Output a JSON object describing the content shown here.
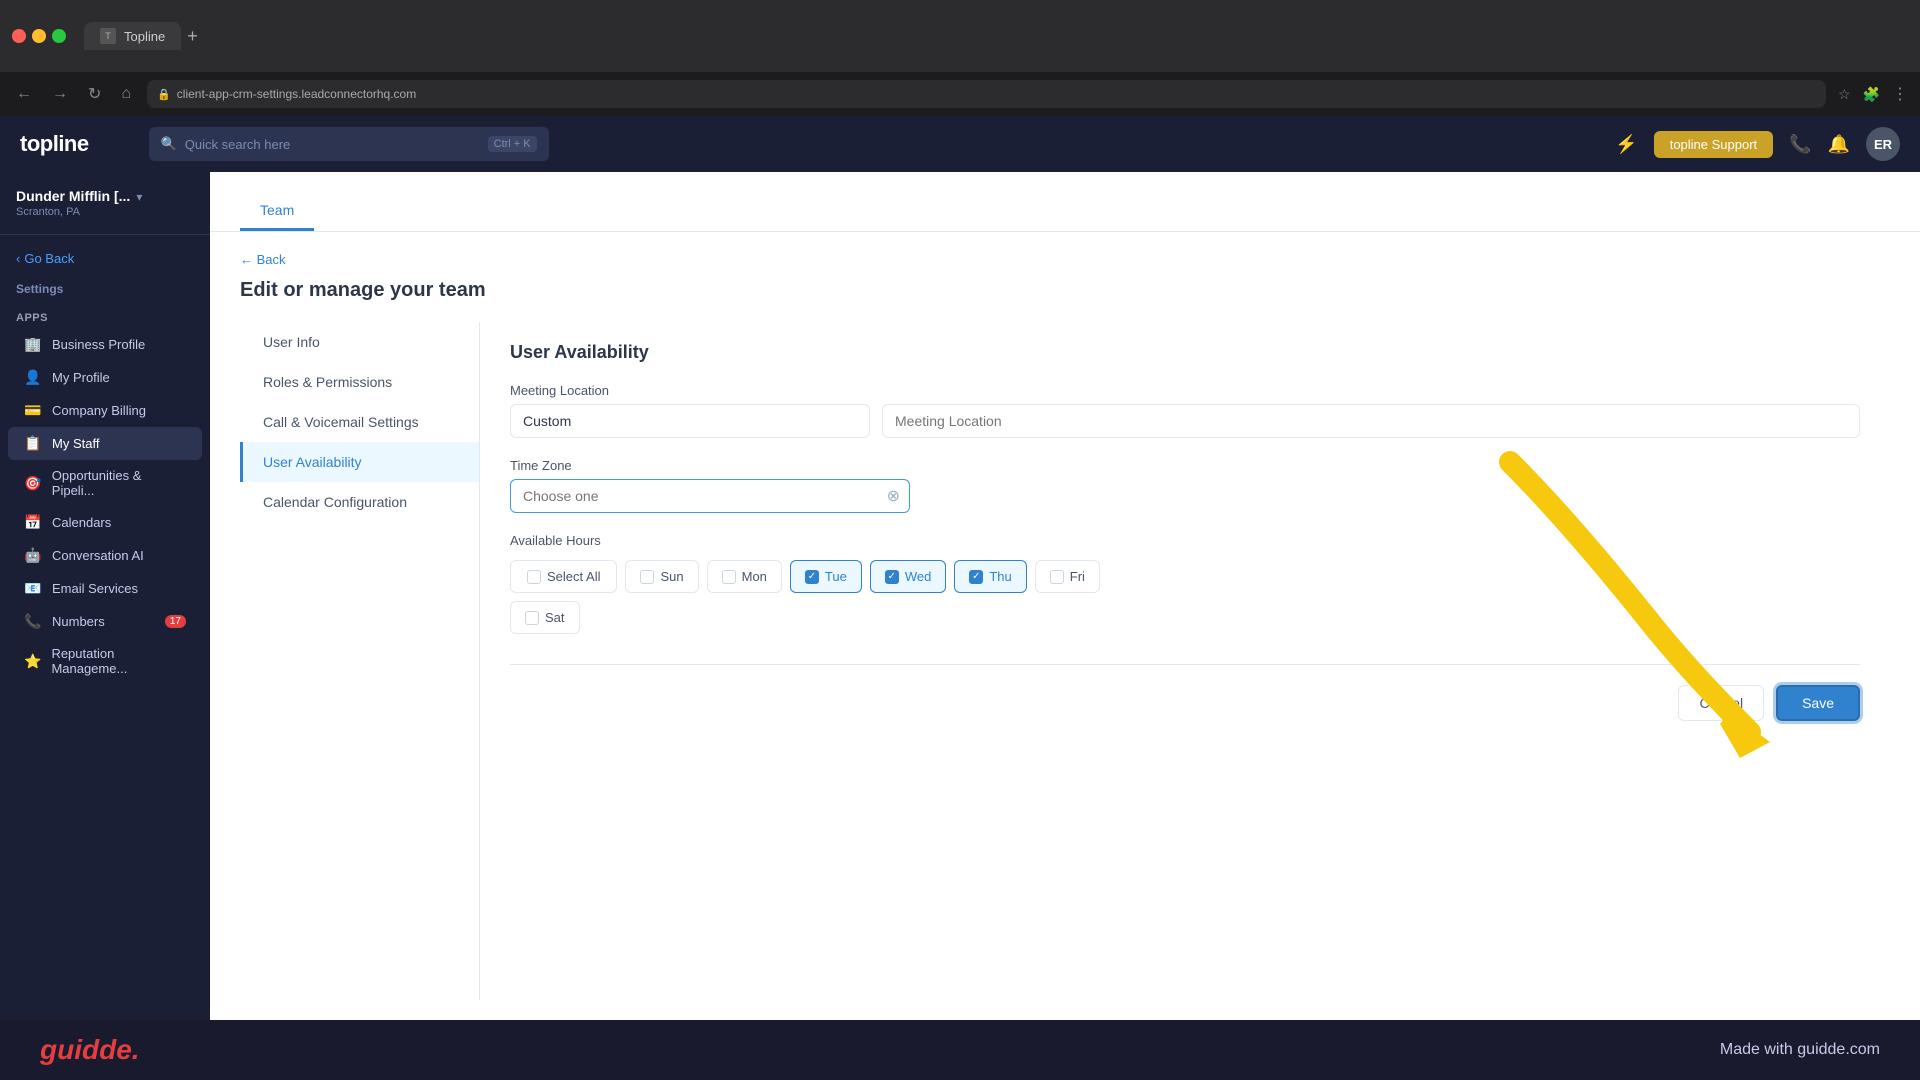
{
  "browser": {
    "tab_title": "Topline",
    "address": "client-app-crm-settings.leadconnectorhq.com",
    "add_tab_label": "+"
  },
  "topnav": {
    "logo": "topline",
    "search_placeholder": "Quick search here",
    "search_shortcut": "Ctrl + K",
    "support_btn": "topline Support",
    "avatar_initials": "ER"
  },
  "sidebar": {
    "org_name": "Dunder Mifflin [...",
    "org_location": "Scranton, PA",
    "go_back": "Go Back",
    "settings_label": "Settings",
    "apps_label": "Apps",
    "items": [
      {
        "id": "business-profile",
        "label": "Business Profile",
        "icon": "🏢",
        "badge": null
      },
      {
        "id": "my-profile",
        "label": "My Profile",
        "icon": "👤",
        "badge": null
      },
      {
        "id": "company-billing",
        "label": "Company Billing",
        "icon": "💳",
        "badge": null
      },
      {
        "id": "my-staff",
        "label": "My Staff",
        "icon": "📋",
        "badge": null,
        "active": true
      },
      {
        "id": "opportunities",
        "label": "Opportunities & Pipeli...",
        "icon": "🎯",
        "badge": null
      },
      {
        "id": "calendars",
        "label": "Calendars",
        "icon": "📅",
        "badge": null
      },
      {
        "id": "conversation-ai",
        "label": "Conversation AI",
        "icon": "🤖",
        "badge": null
      },
      {
        "id": "email-services",
        "label": "Email Services",
        "icon": "📧",
        "badge": null
      },
      {
        "id": "numbers",
        "label": "Numbers",
        "icon": "📞",
        "badge": "17"
      },
      {
        "id": "reputation",
        "label": "Reputation Manageme...",
        "icon": "⭐",
        "badge": null
      }
    ]
  },
  "page": {
    "tab": "Team",
    "back_label": "← Back",
    "title": "Edit or manage your team"
  },
  "left_nav": {
    "items": [
      {
        "id": "user-info",
        "label": "User Info"
      },
      {
        "id": "roles-permissions",
        "label": "Roles & Permissions"
      },
      {
        "id": "call-voicemail",
        "label": "Call & Voicemail Settings"
      },
      {
        "id": "user-availability",
        "label": "User Availability",
        "active": true
      },
      {
        "id": "calendar-config",
        "label": "Calendar Configuration"
      }
    ]
  },
  "form": {
    "section_title": "User Availability",
    "meeting_location_label": "Meeting Location",
    "meeting_location_value": "Custom",
    "meeting_location_placeholder": "Meeting Location",
    "timezone_label": "Time Zone",
    "timezone_placeholder": "Choose one",
    "available_hours_label": "Available Hours",
    "select_all_label": "Select All",
    "days": [
      {
        "id": "sun",
        "label": "Sun",
        "checked": false
      },
      {
        "id": "mon",
        "label": "Mon",
        "checked": false
      },
      {
        "id": "tue",
        "label": "Tue",
        "checked": true
      },
      {
        "id": "wed",
        "label": "Wed",
        "checked": true
      },
      {
        "id": "thu",
        "label": "Thu",
        "checked": true
      },
      {
        "id": "fri",
        "label": "Fri",
        "checked": false
      },
      {
        "id": "sat",
        "label": "Sat",
        "checked": false
      }
    ],
    "cancel_label": "Cancel",
    "save_label": "Save"
  },
  "bottom_bar": {
    "logo": "guidde.",
    "tagline": "Made with guidde.com"
  }
}
